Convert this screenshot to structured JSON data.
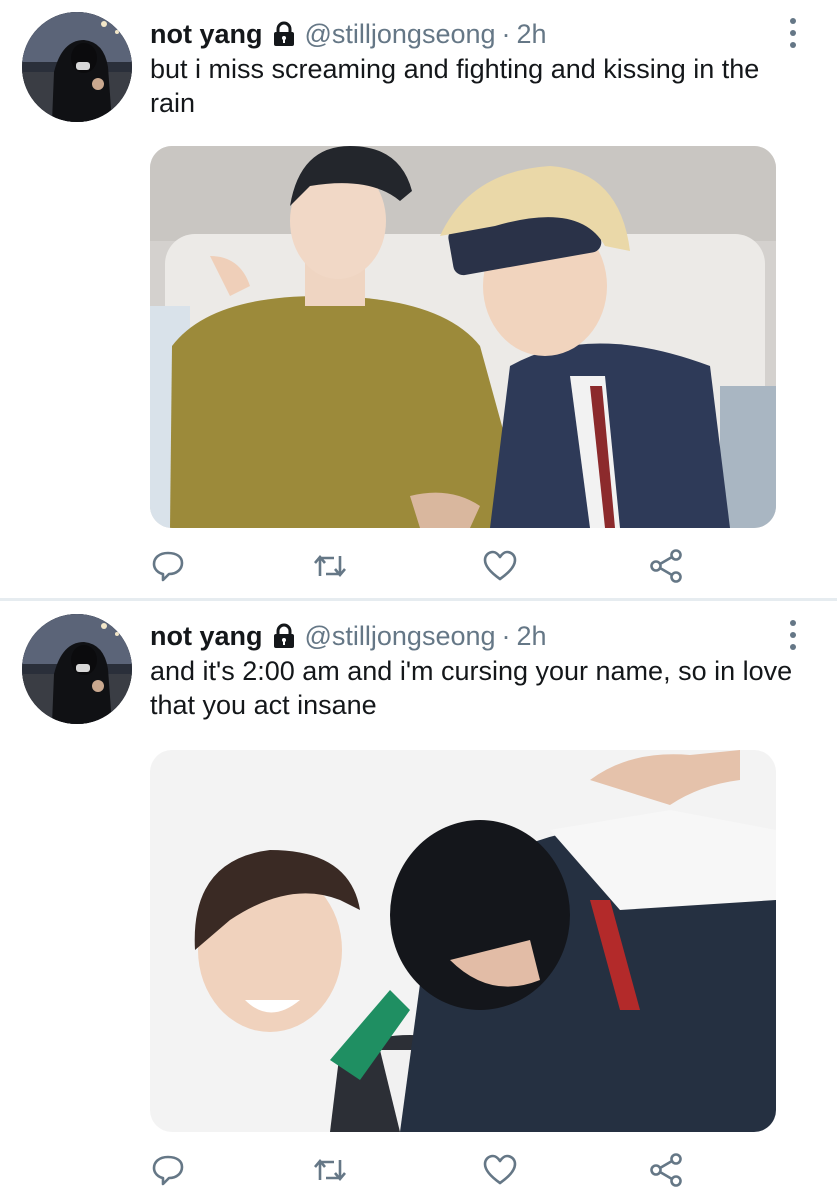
{
  "tweets": [
    {
      "display_name": "not yang",
      "handle": "@stilljongseong",
      "separator": "·",
      "time": "2h",
      "text": "but i miss screaming and fighting and kissing in the rain",
      "icons": [
        "avatar",
        "lock-icon",
        "more-vertical-icon",
        "reply-icon",
        "retweet-icon",
        "like-icon",
        "share-icon"
      ]
    },
    {
      "display_name": "not yang",
      "handle": "@stilljongseong",
      "separator": "·",
      "time": "2h",
      "text": "and it's 2:00 am and i'm cursing your name, so in love that you act insane",
      "icons": [
        "avatar",
        "lock-icon",
        "more-vertical-icon",
        "reply-icon",
        "retweet-icon",
        "like-icon",
        "share-icon"
      ]
    }
  ],
  "colors": {
    "text": "#14171a",
    "secondary": "#657786",
    "divider": "#e6ecf0"
  }
}
